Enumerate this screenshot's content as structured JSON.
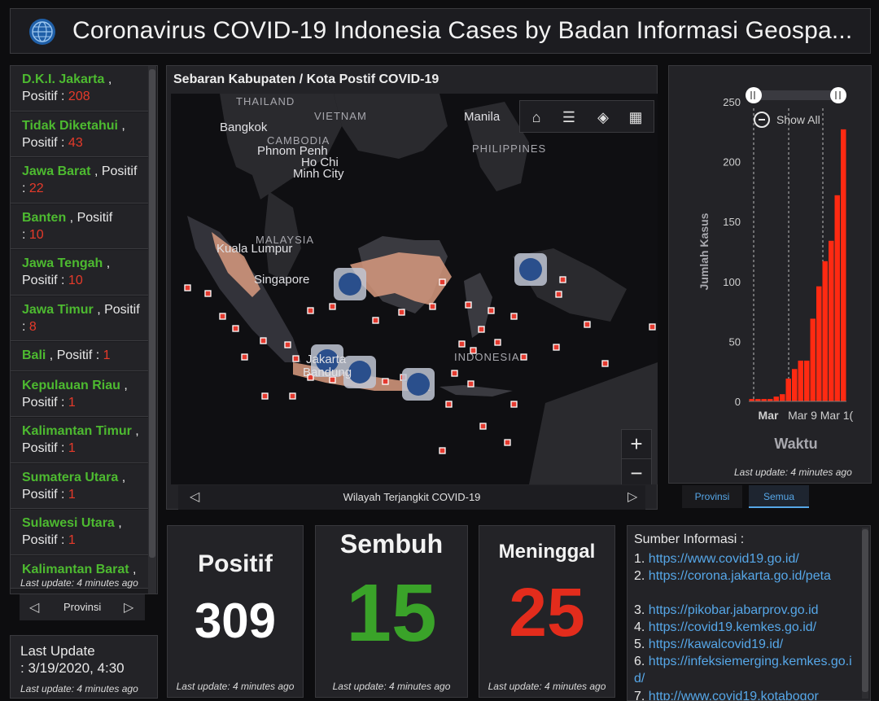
{
  "header": {
    "title": "Coronavirus COVID-19 Indonesia Cases by Badan Informasi Geospa..."
  },
  "provinces": [
    {
      "name": "D.K.I. Jakarta",
      "label": "Positif :",
      "value": "208"
    },
    {
      "name": "Tidak Diketahui",
      "label": "Positif :",
      "value": "43"
    },
    {
      "name": "Jawa Barat",
      "label": "Positif :",
      "value": "22"
    },
    {
      "name": "Banten",
      "label": "Positif",
      "label2": ":",
      "value": "10"
    },
    {
      "name": "Jawa Tengah",
      "label": "Positif :",
      "value": "10"
    },
    {
      "name": "Jawa Timur",
      "label": "Positif :",
      "value": "8"
    },
    {
      "name": "Bali",
      "label": "Positif :",
      "value": "1"
    },
    {
      "name": "Kepulauan Riau",
      "label": "Positif :",
      "value": "1"
    },
    {
      "name": "Kalimantan Timur",
      "label": "Positif :",
      "value": "1"
    },
    {
      "name": "Sumatera Utara",
      "label": "Positif :",
      "value": "1"
    },
    {
      "name": "Sulawesi Utara",
      "label": "Positif :",
      "value": "1"
    },
    {
      "name": "Kalimantan Barat",
      "label": "",
      "value": ""
    }
  ],
  "left_panel": {
    "update": "Last update: 4 minutes ago",
    "nav_label": "Provinsi",
    "last_update_title": "Last Update",
    "last_update_value": ": 3/19/2020, 4:30",
    "last_update_footer": "Last update: 4 minutes ago"
  },
  "map": {
    "title": "Sebaran Kabupaten / Kota Postif COVID-19",
    "footer": "Wilayah Terjangkit COVID-19",
    "place_labels": [
      "THAILAND",
      "VIETNAM",
      "Bangkok",
      "CAMBODIA",
      "Phnom Penh",
      "Ho Chi",
      "Minh City",
      "Manila",
      "PHILIPPINES",
      "MALAYSIA",
      "Kuala Lumpur",
      "Singapore",
      "INDONESIA",
      "Jakarta",
      "Bandung"
    ],
    "zoom_in": "+",
    "zoom_out": "−"
  },
  "chart_data": {
    "type": "bar",
    "ylabel": "Jumlah Kasus",
    "xlabel": "Waktu",
    "yticks": [
      0,
      50,
      100,
      150,
      200,
      250
    ],
    "xticks": [
      "Mar",
      "Mar 9",
      "Mar 1("
    ],
    "ylim": [
      0,
      250
    ],
    "values": [
      2,
      2,
      2,
      2,
      4,
      6,
      19,
      27,
      34,
      34,
      69,
      96,
      117,
      134,
      172,
      227
    ],
    "zoom_label": "Show All",
    "update": "Last update: 4 minutes ago"
  },
  "chart_tabs": [
    "Provinsi",
    "Semua"
  ],
  "stats": {
    "positif": {
      "label": "Positif",
      "value": "309",
      "update": "Last update: 4 minutes ago",
      "color": "#ffffff"
    },
    "sembuh": {
      "label": "Sembuh",
      "value": "15",
      "update": "Last update: 4 minutes ago",
      "color": "#3aa329"
    },
    "meninggal": {
      "label": "Meninggal",
      "value": "25",
      "update": "Last update: 4 minutes ago",
      "color": "#e32c1c"
    }
  },
  "sources": {
    "head": "Sumber Informasi :",
    "items": [
      {
        "n": "1.",
        "url": "https://www.covid19.go.id/"
      },
      {
        "n": "2.",
        "url": "https://corona.jakarta.go.id/peta"
      },
      {
        "n": "3.",
        "url": "https://pikobar.jabarprov.go.id"
      },
      {
        "n": "4.",
        "url": "https://covid19.kemkes.go.id/"
      },
      {
        "n": "5.",
        "url": "https://kawalcovid19.id/"
      },
      {
        "n": "6.",
        "url": "https://infeksiemerging.kemkes.go.id/"
      },
      {
        "n": "7.",
        "url": "http://www.covid19.kotabogor"
      }
    ]
  }
}
